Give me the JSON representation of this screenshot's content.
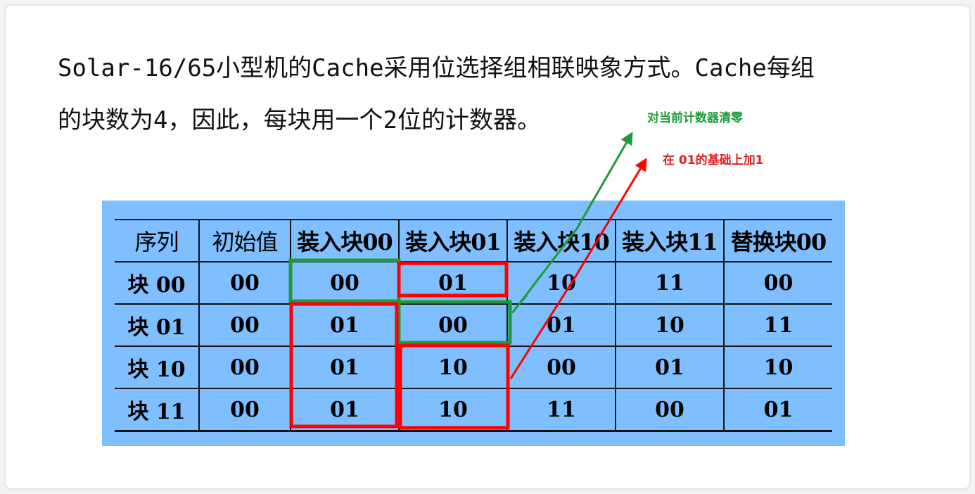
{
  "paragraph": {
    "line1": "Solar-16/65小型机的Cache采用位选择组相联映象方式。Cache每组",
    "line2": " 的块数为4，因此，每块用一个2位的计数器。"
  },
  "notes": {
    "green": "对当前计数器清零",
    "red": "在 01的基础上加1"
  },
  "colors": {
    "green_highlight": "#1f9a3a",
    "red_highlight": "#ff0000",
    "table_background": "#7fbfff"
  },
  "table": {
    "headers": [
      "序列",
      "初始值",
      "装入块00",
      "装入块01",
      "装入块10",
      "装入块11",
      "替换块00"
    ],
    "rows": [
      {
        "label_prefix": "块",
        "label_code": "00",
        "cells": [
          "00",
          "00",
          "01",
          "10",
          "11",
          "00"
        ]
      },
      {
        "label_prefix": "块",
        "label_code": "01",
        "cells": [
          "00",
          "01",
          "00",
          "01",
          "10",
          "11"
        ]
      },
      {
        "label_prefix": "块",
        "label_code": "10",
        "cells": [
          "00",
          "01",
          "10",
          "00",
          "01",
          "10"
        ]
      },
      {
        "label_prefix": "块",
        "label_code": "11",
        "cells": [
          "00",
          "01",
          "10",
          "11",
          "00",
          "01"
        ]
      }
    ]
  }
}
